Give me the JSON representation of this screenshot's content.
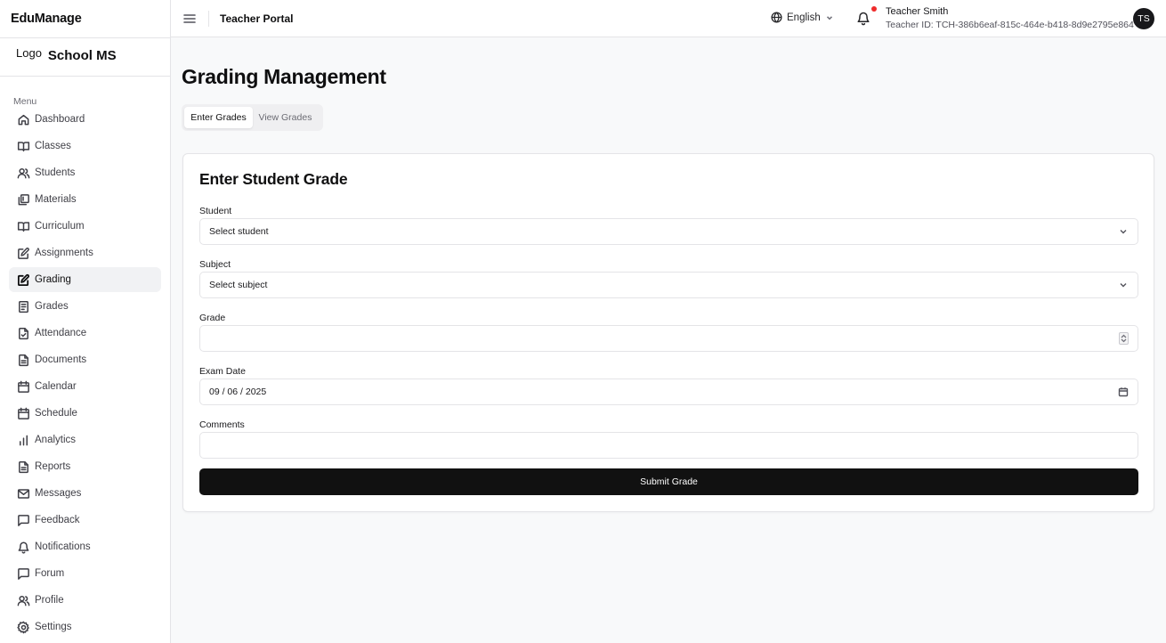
{
  "app": {
    "brand": "EduManage"
  },
  "school": {
    "logo_alt": "Logo",
    "name": "School MS"
  },
  "sidebar": {
    "menu_heading": "Menu",
    "items": [
      {
        "label": "Dashboard",
        "icon": "home-icon"
      },
      {
        "label": "Classes",
        "icon": "book-open-icon"
      },
      {
        "label": "Students",
        "icon": "users-icon"
      },
      {
        "label": "Materials",
        "icon": "library-icon"
      },
      {
        "label": "Curriculum",
        "icon": "book-open-icon"
      },
      {
        "label": "Assignments",
        "icon": "edit-square-icon"
      },
      {
        "label": "Grading",
        "icon": "edit-square-icon",
        "active": true
      },
      {
        "label": "Grades",
        "icon": "notebook-icon"
      },
      {
        "label": "Attendance",
        "icon": "file-check-icon"
      },
      {
        "label": "Documents",
        "icon": "file-text-icon"
      },
      {
        "label": "Calendar",
        "icon": "calendar-icon"
      },
      {
        "label": "Schedule",
        "icon": "calendar-icon"
      },
      {
        "label": "Analytics",
        "icon": "bar-chart-icon"
      },
      {
        "label": "Reports",
        "icon": "file-text-icon"
      },
      {
        "label": "Messages",
        "icon": "mail-icon"
      },
      {
        "label": "Feedback",
        "icon": "message-square-icon"
      },
      {
        "label": "Notifications",
        "icon": "bell-icon"
      },
      {
        "label": "Forum",
        "icon": "message-square-icon"
      },
      {
        "label": "Profile",
        "icon": "users-icon"
      },
      {
        "label": "Settings",
        "icon": "gear-icon"
      }
    ]
  },
  "topbar": {
    "title": "Teacher Portal",
    "language": "English",
    "user_name": "Teacher Smith",
    "user_id": "Teacher ID: TCH-386b6eaf-815c-464e-b418-8d9e2795e864",
    "avatar_initials": "TS",
    "notification_dot_color": "#ef2b2b"
  },
  "main": {
    "page_title": "Grading Management",
    "tabs": [
      {
        "label": "Enter Grades",
        "active": true
      },
      {
        "label": "View Grades",
        "active": false
      }
    ],
    "form": {
      "title": "Enter Student Grade",
      "student_label": "Student",
      "student_value": "Select student",
      "subject_label": "Subject",
      "subject_value": "Select subject",
      "grade_label": "Grade",
      "grade_value": "",
      "exam_date_label": "Exam Date",
      "exam_date_value": "09 / 06 / 2025",
      "comments_label": "Comments",
      "comments_value": "",
      "submit_label": "Submit Grade"
    }
  }
}
